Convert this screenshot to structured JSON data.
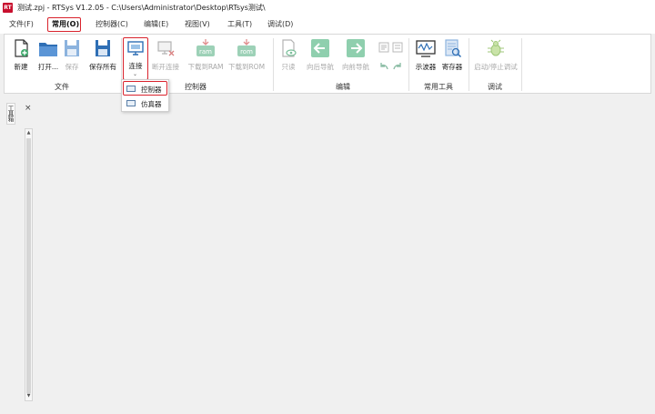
{
  "window": {
    "title": "测试.zpj - RTSys V1.2.05 - C:\\Users\\Administrator\\Desktop\\RTsys测试\\",
    "app_icon_text": "RT"
  },
  "menu": [
    {
      "label": "文件(F)"
    },
    {
      "label": "常用(O)"
    },
    {
      "label": "控制器(C)"
    },
    {
      "label": "编辑(E)"
    },
    {
      "label": "视图(V)"
    },
    {
      "label": "工具(T)"
    },
    {
      "label": "调试(D)"
    }
  ],
  "ribbon": {
    "groups": [
      {
        "label": "文件"
      },
      {
        "label": "控制器"
      },
      {
        "label": "编辑"
      },
      {
        "label": "常用工具"
      },
      {
        "label": "调试"
      }
    ],
    "buttons": [
      {
        "label": "新建",
        "icon": "new-file-icon"
      },
      {
        "label": "打开...",
        "icon": "open-folder-icon"
      },
      {
        "label": "保存",
        "icon": "save-icon"
      },
      {
        "label": "保存所有",
        "icon": "save-all-icon"
      },
      {
        "label": "连接",
        "icon": "connect-icon"
      },
      {
        "label": "断开连接",
        "icon": "disconnect-icon"
      },
      {
        "label": "下载到RAM",
        "icon": "download-ram-icon",
        "icon_text": "ram"
      },
      {
        "label": "下载到ROM",
        "icon": "download-rom-icon",
        "icon_text": "rom"
      },
      {
        "label": "只读",
        "icon": "read-only-icon"
      },
      {
        "label": "向后导航",
        "icon": "navigate-back-icon"
      },
      {
        "label": "向前导航",
        "icon": "navigate-forward-icon"
      },
      {
        "label": "示波器",
        "icon": "oscilloscope-icon"
      },
      {
        "label": "寄存器",
        "icon": "register-icon"
      },
      {
        "label": "启动/停止调试",
        "icon": "debug-bug-icon"
      }
    ]
  },
  "connect_dropdown": {
    "items": [
      {
        "label": "控制器",
        "icon": "controller-icon"
      },
      {
        "label": "仿真器",
        "icon": "simulator-icon"
      }
    ]
  },
  "side_panel": {
    "tab_label": "工具箱",
    "close_glyph": "×"
  },
  "colors": {
    "highlight_red": "#d9232d",
    "icon_blue": "#2f6fb5",
    "icon_green": "#3ea86b"
  }
}
